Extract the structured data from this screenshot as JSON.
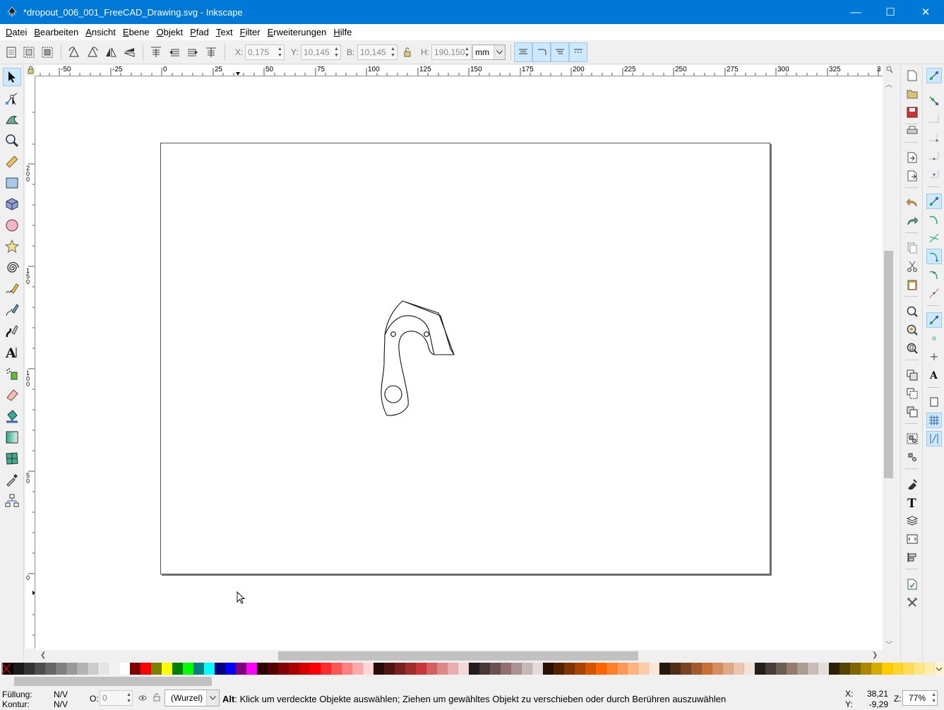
{
  "window": {
    "title": "*dropout_006_001_FreeCAD_Drawing.svg - Inkscape",
    "minimize": "—",
    "maximize": "☐",
    "close": "✕"
  },
  "menu": [
    {
      "u": "D",
      "rest": "atei"
    },
    {
      "u": "B",
      "rest": "earbeiten"
    },
    {
      "u": "A",
      "rest": "nsicht"
    },
    {
      "u": "E",
      "rest": "bene"
    },
    {
      "u": "O",
      "rest": "bjekt"
    },
    {
      "u": "P",
      "rest": "fad"
    },
    {
      "u": "T",
      "rest": "ext"
    },
    {
      "u": "F",
      "rest": "ilter"
    },
    {
      "u": "E",
      "rest": "rweiterungen"
    },
    {
      "u": "H",
      "rest": "ilfe"
    }
  ],
  "toolbar": {
    "x_label": "X:",
    "x_value": "0,175",
    "y_label": "Y:",
    "y_value": "10,145",
    "w_label": "B:",
    "w_value": "10,145",
    "h_label": "H:",
    "h_value": "190,150",
    "unit": "mm"
  },
  "ruler": {
    "top_labels": [
      "-50",
      "-25",
      "0",
      "25",
      "50",
      "75",
      "100",
      "125",
      "150",
      "175",
      "200",
      "225",
      "250",
      "275",
      "300",
      "325",
      "3"
    ],
    "left_labels": [
      "200",
      "150",
      "100",
      "50",
      "0"
    ]
  },
  "status": {
    "fill_label": "Füllung:",
    "fill_value": "N/V",
    "stroke_label": "Kontur:",
    "stroke_value": "N/V",
    "opacity_label": "O:",
    "opacity_value": "0",
    "layer": "(Wurzel)",
    "message_key": "Alt",
    "message": ": Klick um verdeckte Objekte auswählen; Ziehen um gewähltes Objekt zu verschieben oder durch Berühren auszuwählen",
    "x_label": "X:",
    "x_value": "38,21",
    "y_label": "Y:",
    "y_value": "-9,29",
    "zoom_label": "Z:",
    "zoom_value": "77%"
  },
  "palette": [
    "#000000",
    "#1a1a1a",
    "#333333",
    "#4d4d4d",
    "#666666",
    "#808080",
    "#999999",
    "#b3b3b3",
    "#cccccc",
    "#e6e6e6",
    "#f2f2f2",
    "#ffffff",
    "#800000",
    "#ff0000",
    "#808000",
    "#ffff00",
    "#008000",
    "#00ff00",
    "#008080",
    "#00ffff",
    "#000080",
    "#0000ff",
    "#800080",
    "#ff00ff",
    "#2b0000",
    "#550000",
    "#800000",
    "#aa0000",
    "#d40000",
    "#ff0000",
    "#ff2a2a",
    "#ff5555",
    "#ff8080",
    "#ffaaaa",
    "#ffd5d5",
    "#280b0b",
    "#501616",
    "#782121",
    "#a02c2c",
    "#c83737",
    "#d35f5f",
    "#de8787",
    "#e9afaf",
    "#f4d7d7",
    "#241c1c",
    "#483737",
    "#6c5353",
    "#916f6f",
    "#ac9393",
    "#c8b7b7",
    "#e3dbdb",
    "#2b1100",
    "#552200",
    "#803300",
    "#aa4400",
    "#d45500",
    "#ff6600",
    "#ff7f2a",
    "#ff9955",
    "#ffb380",
    "#ffccaa",
    "#ffe6d5",
    "#28170b",
    "#502d16",
    "#784421",
    "#a05a2c",
    "#c87137",
    "#d38d5f",
    "#deaa87",
    "#e9c6af",
    "#f4e3d7",
    "#241f1c",
    "#483e37",
    "#6c5d53",
    "#917c6f",
    "#ac9d93",
    "#c8beb7",
    "#e3dedb",
    "#2b2200",
    "#554400",
    "#806600",
    "#aa8800",
    "#d4aa00",
    "#ffcc00",
    "#ffd42a",
    "#ffdd55",
    "#ffe680",
    "#ffeeaa",
    "#fff6d5",
    "#28220b",
    "#504416",
    "#786721"
  ]
}
